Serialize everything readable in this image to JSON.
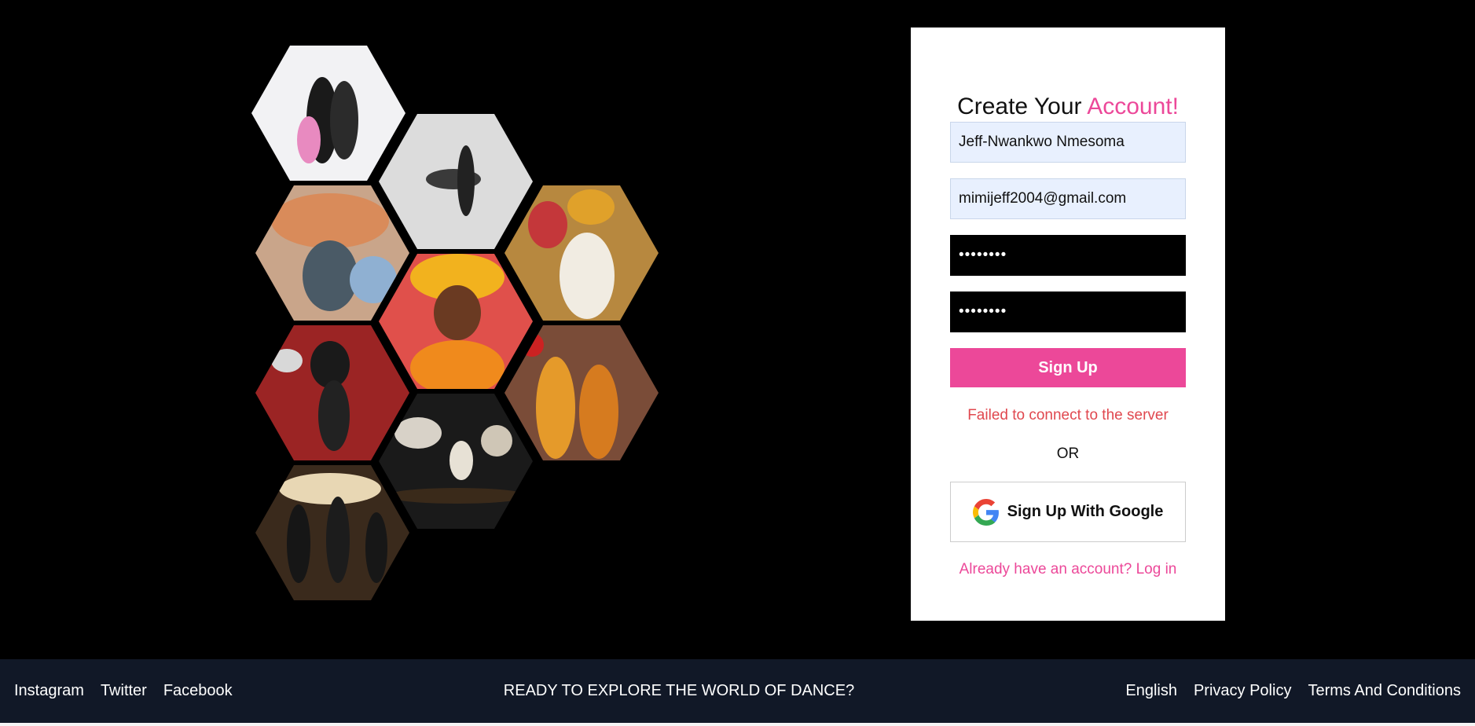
{
  "signup": {
    "title_prefix": "Create Your ",
    "title_accent": "Account!",
    "name_value": "Jeff-Nwankwo Nmesoma",
    "email_value": "mimijeff2004@gmail.com",
    "password_value": "••••••••",
    "confirm_password_value": "••••••••",
    "signup_button": "Sign Up",
    "error_message": "Failed to connect to the server",
    "divider": "OR",
    "google_button": "Sign Up With Google",
    "google_icon": "google-g-icon",
    "login_link": "Already have an account? Log in"
  },
  "collage": {
    "photos": [
      "dancers-duo-high-kick",
      "contemporary-dance-lift",
      "african-dancers-festival",
      "street-dance-mural",
      "dancer-floral-headdress",
      "dancer-leaping-red-backdrop",
      "dancers-traditional-outfits",
      "group-stage-leap",
      "dance-crew-stage-lights"
    ]
  },
  "footer": {
    "social_links": [
      "Instagram",
      "Twitter",
      "Facebook"
    ],
    "tagline": "READY TO EXPLORE THE WORLD OF DANCE?",
    "right_links": [
      "English",
      "Privacy Policy",
      "Terms And Conditions"
    ]
  },
  "colors": {
    "accent": "#ec4899",
    "error": "#e0484f",
    "footer_bg": "#111827",
    "page_bg": "#000000",
    "autofill_bg": "#e8f0fe"
  }
}
